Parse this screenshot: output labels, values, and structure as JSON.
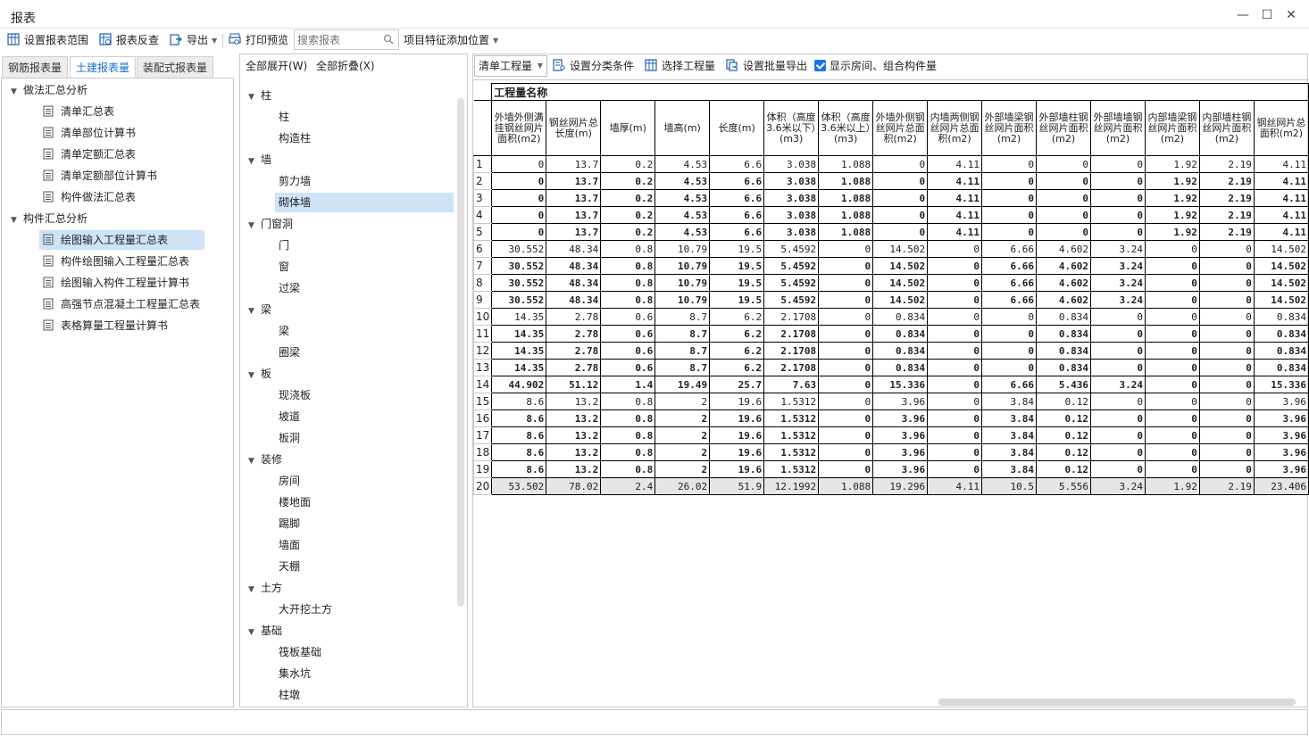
{
  "window": {
    "title": "报表",
    "minimize": "—",
    "maximize": "☐",
    "close": "✕"
  },
  "toolbar": {
    "set_range": "设置报表范围",
    "reverse_check": "报表反查",
    "export": "导出",
    "print_preview": "打印预览",
    "search_placeholder": "搜索报表",
    "feature_position": "项目特征添加位置"
  },
  "left_tabs": [
    "钢筋报表量",
    "土建报表量",
    "装配式报表量"
  ],
  "left_tree": {
    "group1": "做法汇总分析",
    "group1_items": [
      "清单汇总表",
      "清单部位计算书",
      "清单定额汇总表",
      "清单定额部位计算书",
      "构件做法汇总表"
    ],
    "group2": "构件汇总分析",
    "group2_items": [
      "绘图输入工程量汇总表",
      "构件绘图输入工程量汇总表",
      "绘图输入构件工程量计算书",
      "高强节点混凝土工程量汇总表",
      "表格算量工程量计算书"
    ]
  },
  "middle": {
    "expand_all": "全部展开(W)",
    "collapse_all": "全部折叠(X)",
    "groups": [
      {
        "name": "柱",
        "items": [
          "柱",
          "构造柱"
        ]
      },
      {
        "name": "墙",
        "items": [
          "剪力墙",
          "砌体墙"
        ]
      },
      {
        "name": "门窗洞",
        "items": [
          "门",
          "窗",
          "过梁"
        ]
      },
      {
        "name": "梁",
        "items": [
          "梁",
          "圈梁"
        ]
      },
      {
        "name": "板",
        "items": [
          "现浇板",
          "坡道",
          "板洞"
        ]
      },
      {
        "name": "装修",
        "items": [
          "房间",
          "楼地面",
          "踢脚",
          "墙面",
          "天棚"
        ]
      },
      {
        "name": "土方",
        "items": [
          "大开挖土方"
        ]
      },
      {
        "name": "基础",
        "items": [
          "筏板基础",
          "集水坑",
          "柱墩"
        ]
      }
    ]
  },
  "right_toolbar": {
    "combo_value": "清单工程量",
    "set_category": "设置分类条件",
    "select_quantity": "选择工程量",
    "batch_export": "设置批量导出",
    "show_room": "显示房间、组合构件量"
  },
  "table": {
    "title": "工程量名称",
    "headers": [
      "外墙外侧满挂钢丝网片面积(m2)",
      "钢丝网片总长度(m)",
      "墙厚(m)",
      "墙高(m)",
      "长度(m)",
      "体积（高度3.6米以下）(m3)",
      "体积（高度3.6米以上）(m3)",
      "外墙外侧钢丝网片总面积(m2)",
      "内墙两侧钢丝网片总面积(m2)",
      "外部墙梁钢丝网片面积(m2)",
      "外部墙柱钢丝网片面积(m2)",
      "外部墙墙钢丝网片面积(m2)",
      "内部墙梁钢丝网片面积(m2)",
      "内部墙柱钢丝网片面积(m2)",
      "钢丝网片总面积(m2)"
    ],
    "rows": [
      {
        "n": "1",
        "bold": false,
        "v": [
          "0",
          "13.7",
          "0.2",
          "4.53",
          "6.6",
          "3.038",
          "1.088",
          "0",
          "4.11",
          "0",
          "0",
          "0",
          "1.92",
          "2.19",
          "4.11"
        ]
      },
      {
        "n": "2",
        "bold": true,
        "v": [
          "0",
          "13.7",
          "0.2",
          "4.53",
          "6.6",
          "3.038",
          "1.088",
          "0",
          "4.11",
          "0",
          "0",
          "0",
          "1.92",
          "2.19",
          "4.11"
        ]
      },
      {
        "n": "3",
        "bold": true,
        "v": [
          "0",
          "13.7",
          "0.2",
          "4.53",
          "6.6",
          "3.038",
          "1.088",
          "0",
          "4.11",
          "0",
          "0",
          "0",
          "1.92",
          "2.19",
          "4.11"
        ]
      },
      {
        "n": "4",
        "bold": true,
        "v": [
          "0",
          "13.7",
          "0.2",
          "4.53",
          "6.6",
          "3.038",
          "1.088",
          "0",
          "4.11",
          "0",
          "0",
          "0",
          "1.92",
          "2.19",
          "4.11"
        ]
      },
      {
        "n": "5",
        "bold": true,
        "v": [
          "0",
          "13.7",
          "0.2",
          "4.53",
          "6.6",
          "3.038",
          "1.088",
          "0",
          "4.11",
          "0",
          "0",
          "0",
          "1.92",
          "2.19",
          "4.11"
        ]
      },
      {
        "n": "6",
        "bold": false,
        "v": [
          "30.552",
          "48.34",
          "0.8",
          "10.79",
          "19.5",
          "5.4592",
          "0",
          "14.502",
          "0",
          "6.66",
          "4.602",
          "3.24",
          "0",
          "0",
          "14.502"
        ]
      },
      {
        "n": "7",
        "bold": true,
        "v": [
          "30.552",
          "48.34",
          "0.8",
          "10.79",
          "19.5",
          "5.4592",
          "0",
          "14.502",
          "0",
          "6.66",
          "4.602",
          "3.24",
          "0",
          "0",
          "14.502"
        ]
      },
      {
        "n": "8",
        "bold": true,
        "v": [
          "30.552",
          "48.34",
          "0.8",
          "10.79",
          "19.5",
          "5.4592",
          "0",
          "14.502",
          "0",
          "6.66",
          "4.602",
          "3.24",
          "0",
          "0",
          "14.502"
        ]
      },
      {
        "n": "9",
        "bold": true,
        "v": [
          "30.552",
          "48.34",
          "0.8",
          "10.79",
          "19.5",
          "5.4592",
          "0",
          "14.502",
          "0",
          "6.66",
          "4.602",
          "3.24",
          "0",
          "0",
          "14.502"
        ]
      },
      {
        "n": "10",
        "bold": false,
        "v": [
          "14.35",
          "2.78",
          "0.6",
          "8.7",
          "6.2",
          "2.1708",
          "0",
          "0.834",
          "0",
          "0",
          "0.834",
          "0",
          "0",
          "0",
          "0.834"
        ]
      },
      {
        "n": "11",
        "bold": true,
        "v": [
          "14.35",
          "2.78",
          "0.6",
          "8.7",
          "6.2",
          "2.1708",
          "0",
          "0.834",
          "0",
          "0",
          "0.834",
          "0",
          "0",
          "0",
          "0.834"
        ]
      },
      {
        "n": "12",
        "bold": true,
        "v": [
          "14.35",
          "2.78",
          "0.6",
          "8.7",
          "6.2",
          "2.1708",
          "0",
          "0.834",
          "0",
          "0",
          "0.834",
          "0",
          "0",
          "0",
          "0.834"
        ]
      },
      {
        "n": "13",
        "bold": true,
        "v": [
          "14.35",
          "2.78",
          "0.6",
          "8.7",
          "6.2",
          "2.1708",
          "0",
          "0.834",
          "0",
          "0",
          "0.834",
          "0",
          "0",
          "0",
          "0.834"
        ]
      },
      {
        "n": "14",
        "bold": true,
        "v": [
          "44.902",
          "51.12",
          "1.4",
          "19.49",
          "25.7",
          "7.63",
          "0",
          "15.336",
          "0",
          "6.66",
          "5.436",
          "3.24",
          "0",
          "0",
          "15.336"
        ]
      },
      {
        "n": "15",
        "bold": false,
        "v": [
          "8.6",
          "13.2",
          "0.8",
          "2",
          "19.6",
          "1.5312",
          "0",
          "3.96",
          "0",
          "3.84",
          "0.12",
          "0",
          "0",
          "0",
          "3.96"
        ]
      },
      {
        "n": "16",
        "bold": true,
        "v": [
          "8.6",
          "13.2",
          "0.8",
          "2",
          "19.6",
          "1.5312",
          "0",
          "3.96",
          "0",
          "3.84",
          "0.12",
          "0",
          "0",
          "0",
          "3.96"
        ]
      },
      {
        "n": "17",
        "bold": true,
        "v": [
          "8.6",
          "13.2",
          "0.8",
          "2",
          "19.6",
          "1.5312",
          "0",
          "3.96",
          "0",
          "3.84",
          "0.12",
          "0",
          "0",
          "0",
          "3.96"
        ]
      },
      {
        "n": "18",
        "bold": true,
        "v": [
          "8.6",
          "13.2",
          "0.8",
          "2",
          "19.6",
          "1.5312",
          "0",
          "3.96",
          "0",
          "3.84",
          "0.12",
          "0",
          "0",
          "0",
          "3.96"
        ]
      },
      {
        "n": "19",
        "bold": true,
        "v": [
          "8.6",
          "13.2",
          "0.8",
          "2",
          "19.6",
          "1.5312",
          "0",
          "3.96",
          "0",
          "3.84",
          "0.12",
          "0",
          "0",
          "0",
          "3.96"
        ]
      },
      {
        "n": "20",
        "bold": false,
        "total": true,
        "v": [
          "53.502",
          "78.02",
          "2.4",
          "26.02",
          "51.9",
          "12.1992",
          "1.088",
          "19.296",
          "4.11",
          "10.5",
          "5.556",
          "3.24",
          "1.92",
          "2.19",
          "23.406"
        ]
      }
    ]
  }
}
